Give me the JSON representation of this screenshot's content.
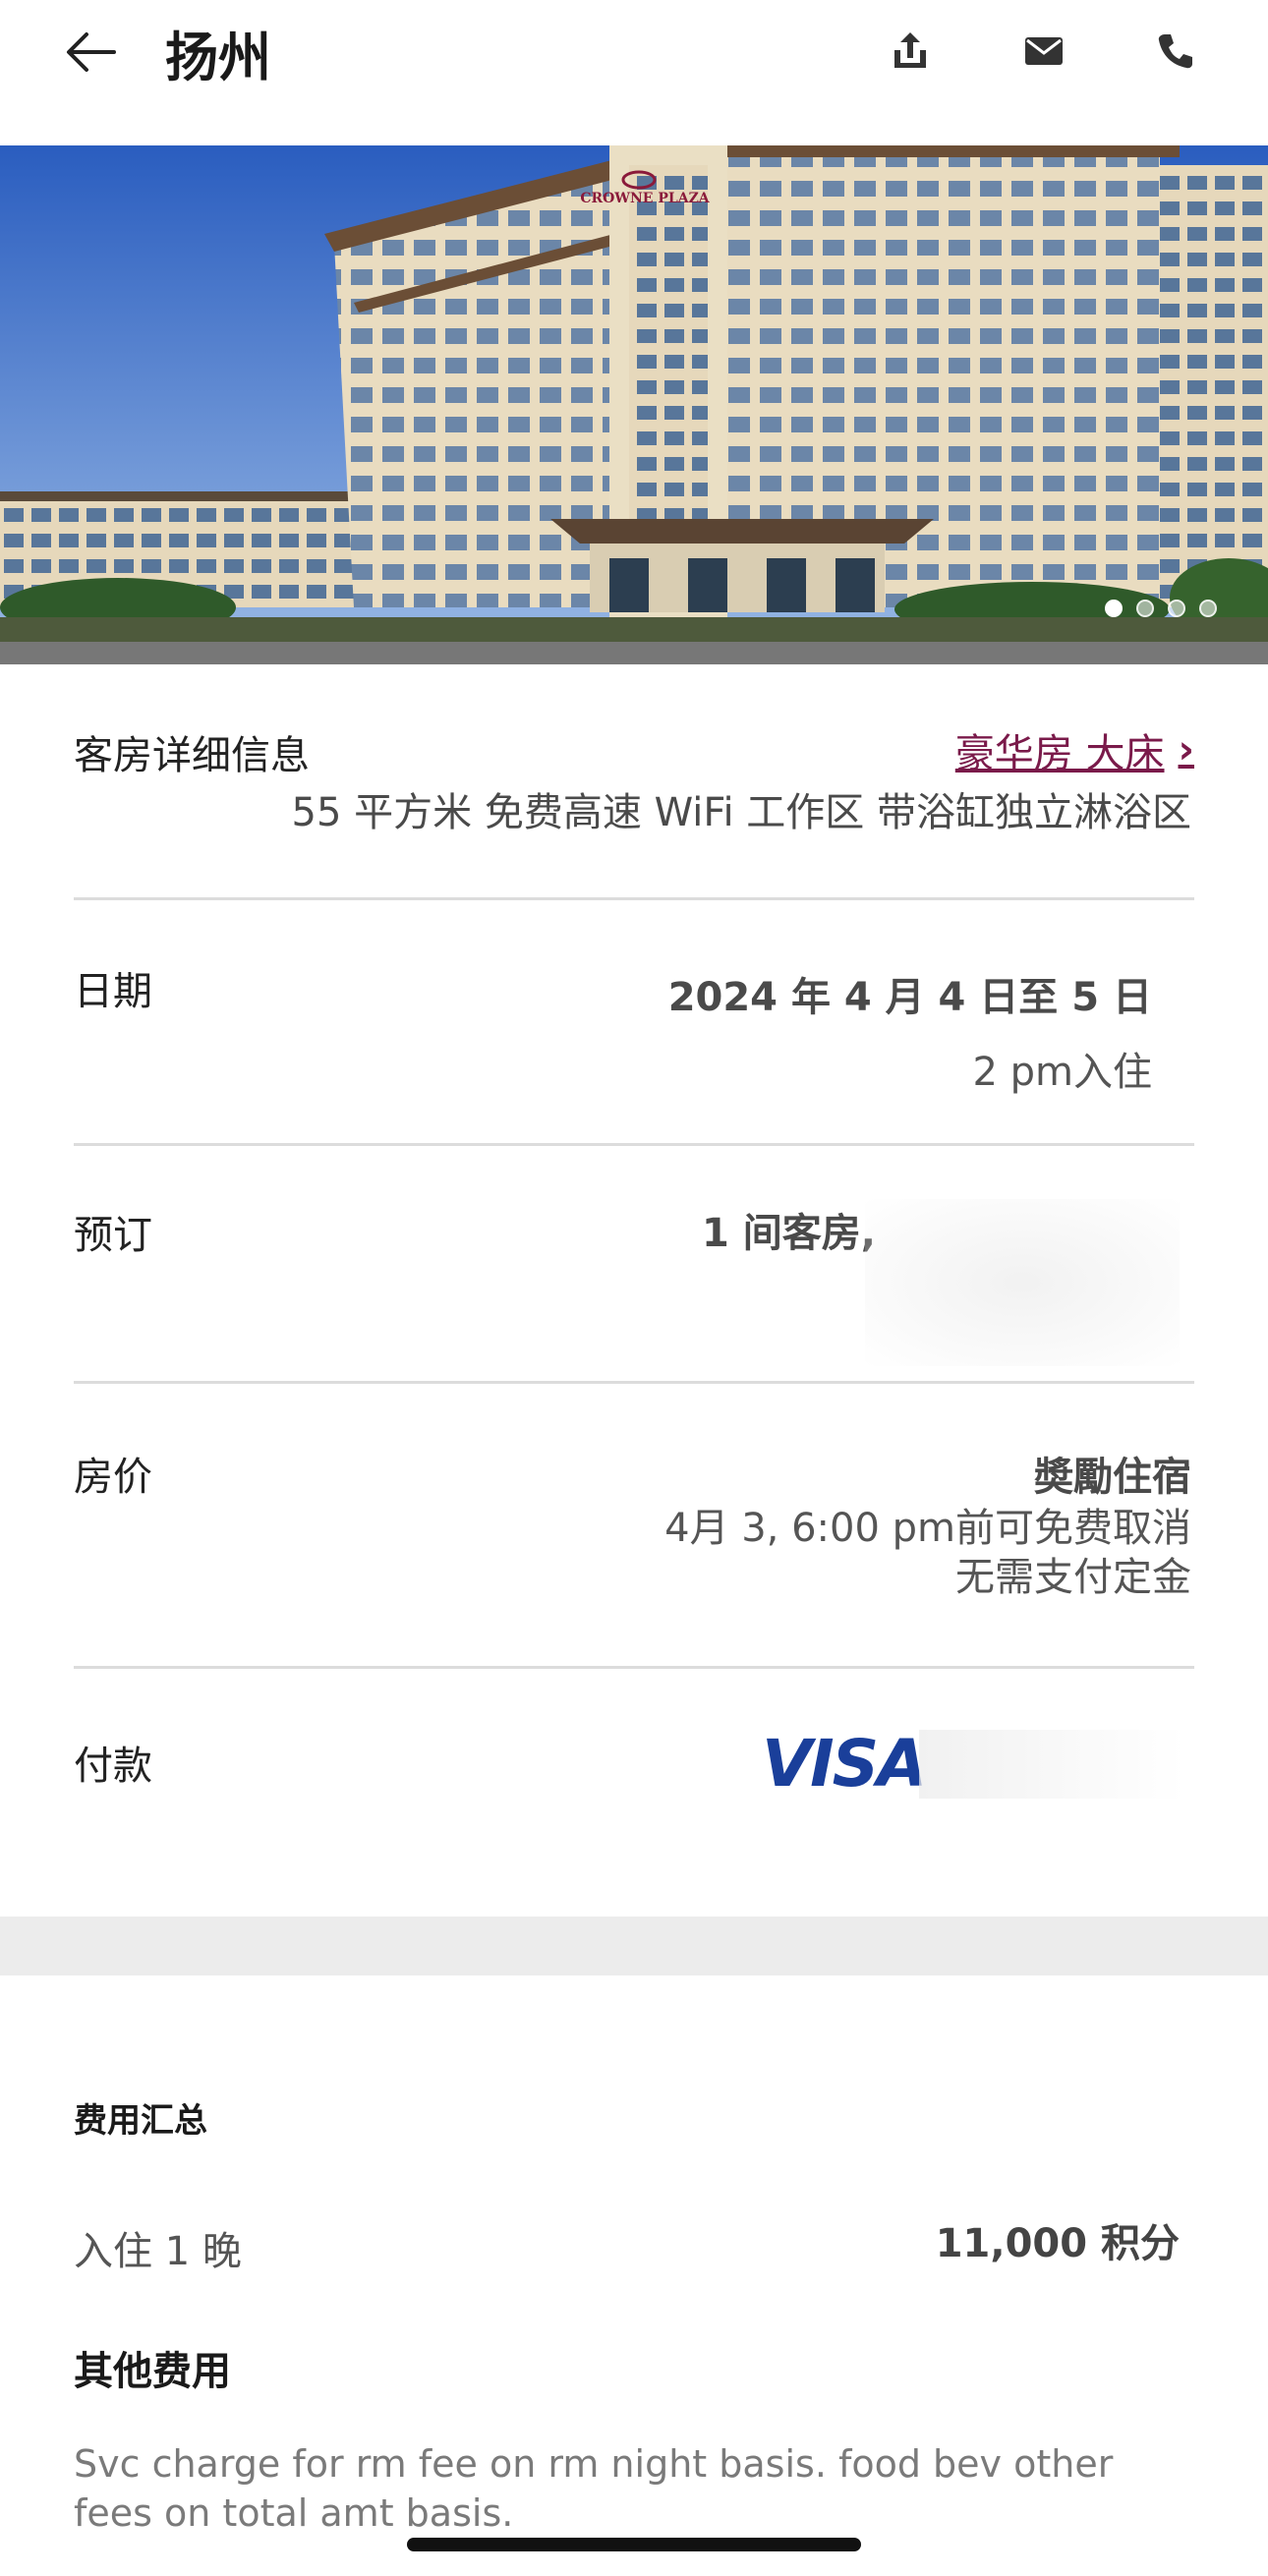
{
  "header": {
    "title": "扬州",
    "back_icon": "arrow-left-icon",
    "actions": [
      "share-icon",
      "mail-icon",
      "phone-icon"
    ]
  },
  "hero": {
    "image_alt": "hotel-exterior-photo",
    "sign_text": "CROWNE PLAZA",
    "carousel_total": 4,
    "carousel_active": 1
  },
  "room": {
    "label": "客房详细信息",
    "type_link": "豪华房 大床",
    "amenities": "55 平方米 免费高速 WiFi 工作区 带浴缸独立淋浴区"
  },
  "dates": {
    "label": "日期",
    "range": "2024 年 4 月 4 日至 5 日",
    "checkin": "2 pm入住"
  },
  "booking": {
    "label": "预订",
    "value": "1 间客房,"
  },
  "rate": {
    "label": "房价",
    "type": "奬勵住宿",
    "cancel": "4月 3, 6:00 pm前可免费取消",
    "deposit": "无需支付定金"
  },
  "payment": {
    "label": "付款",
    "card_brand": "VISA"
  },
  "summary": {
    "title": "费用汇总",
    "night_label": "入住 1 晚",
    "points": "11,000 积分",
    "other_title": "其他费用",
    "other_text": "Svc charge for rm fee on rm night basis. food bev other fees on total amt basis."
  },
  "colors": {
    "accent": "#7a1a4a",
    "visa": "#1a3f9a",
    "divider": "#dcdcdc",
    "band": "#ececec"
  }
}
